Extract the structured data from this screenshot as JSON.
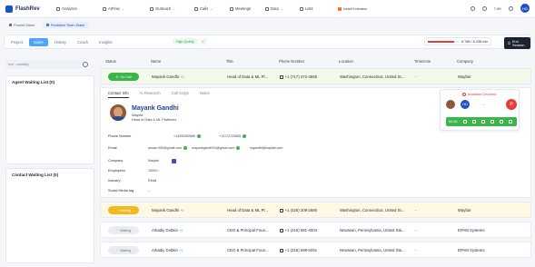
{
  "brand": {
    "name": "FlashRev"
  },
  "nav": {
    "items": [
      {
        "label": "Analytics",
        "icon": "analytics-icon",
        "caret": ""
      },
      {
        "label": "AIFlow",
        "icon": "flow-icon",
        "caret": "⌄"
      },
      {
        "label": "Outreach",
        "icon": "outreach-icon",
        "caret": "⌄"
      },
      {
        "label": "Calls",
        "icon": "phone-icon",
        "caret": "⌄"
      },
      {
        "label": "Meetings",
        "icon": "calendar-icon",
        "caret": ""
      },
      {
        "label": "Data",
        "icon": "database-icon",
        "caret": "⌄"
      },
      {
        "label": "Lists",
        "icon": "list-icon",
        "caret": ""
      }
    ],
    "install_label": "Install Extension",
    "language": "7.9K",
    "avatar_initials": "HD"
  },
  "subtabs": [
    {
      "label": "Parallel Dialer",
      "active": false
    },
    {
      "label": "Predictive Team Dialer",
      "active": true
    }
  ],
  "modebar": {
    "tabs": [
      {
        "label": "Project",
        "active": false
      },
      {
        "label": "Dialer",
        "active": true
      },
      {
        "label": "History",
        "active": false
      },
      {
        "label": "Coach",
        "active": false
      },
      {
        "label": "Insights",
        "active": false
      }
    ],
    "quality_label": "High Quality",
    "minutes_text": "8,788 / 8,338 min",
    "minutes_fraction": 0.85,
    "end_session_label": "End Session"
  },
  "left": {
    "search_placeholder": "test - subsidity",
    "agent_waiting": "Agent Waiting List (0)",
    "contact_waiting": "Contact Waiting List (0)"
  },
  "table": {
    "columns": [
      "Status",
      "Name",
      "Title",
      "Phone Number",
      "Location",
      "Timezone",
      "Company"
    ],
    "rows": [
      {
        "status": "On Call",
        "status_type": "oncall",
        "name": "Mayank Gandhi",
        "tag": "+0",
        "title": "Head of Data & ML Pl...",
        "phone": "+1 (717) 272-3655",
        "location": "Washington, Connecticut, United St...",
        "timezone": "-",
        "company": "Wayfair"
      },
      {
        "status": "Waiting",
        "status_type": "waiting",
        "name": "Mayank Gandhi",
        "tag": "+0",
        "title": "Head of Data & ML Pl...",
        "phone": "+1 (425) 209-2680",
        "location": "Washington, Connecticut, United St...",
        "timezone": "-",
        "company": "Wayfair"
      },
      {
        "status": "Waiting",
        "status_type": "idle",
        "name": "Arkadiy Dobkin",
        "tag": "+0",
        "title": "CEO & Principal Foun...",
        "phone": "+1 (416) 591-4004",
        "location": "Newtown, Pennsylvania, United Sta...",
        "timezone": "-",
        "company": "EPAM Systems"
      },
      {
        "status": "Waiting",
        "status_type": "idle",
        "name": "Arkadiy Dobkin",
        "tag": "+0",
        "title": "CEO & Principal Foun...",
        "phone": "+1 (215) 598-9251",
        "location": "Newtown, Pennsylvania, United Sta...",
        "timezone": "-",
        "company": "EPAM Systems"
      }
    ]
  },
  "detail": {
    "tabs": [
      "Contact Info",
      "AI Research",
      "Call Script",
      "Notes"
    ],
    "name": "Mayank Gandhi",
    "company": "Wayfair",
    "title": "Head of Data & ML Platforms",
    "fields": {
      "phone_label": "Phone Number",
      "phones": [
        "+14252092680",
        "+13172723655"
      ],
      "email_label": "Email",
      "emails": [
        "anuan.050@gmail.com",
        "mayankgandhi7d@gmail.com",
        "mgandhi@wayfair.com"
      ],
      "company_label": "Company",
      "company_value": "Wayfair",
      "employees_label": "Employees",
      "employees_value": "10001+",
      "industry_label": "Industry",
      "industry_value": "Retail",
      "social_label": "Social Media tag",
      "social_value": "--"
    }
  },
  "call_widget": {
    "invitation": "Invitation Declined",
    "timer": "00:06",
    "logo_text": "HD"
  }
}
